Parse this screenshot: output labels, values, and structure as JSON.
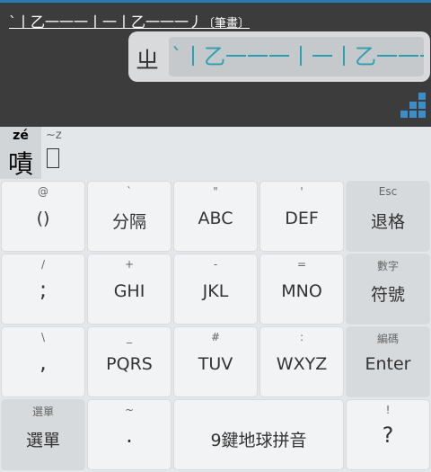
{
  "composing": {
    "strokes_text": "`丨乙一一一丨一丨乙一一一丿",
    "hint_text": "〔筆畫〕"
  },
  "bubble": {
    "key_char": "ㄓ",
    "strokes_text": "`丨乙一一一丨一丨乙一一一"
  },
  "candidates": {
    "main_pinyin": "zé",
    "main_char": "嘖",
    "alt_hint": "~z",
    "alt_char": ""
  },
  "keyboard": {
    "row1": [
      {
        "hint": "@",
        "label": "()"
      },
      {
        "hint": "`",
        "label": "分隔"
      },
      {
        "hint": "\"",
        "label": "ABC"
      },
      {
        "hint": "'",
        "label": "DEF"
      },
      {
        "hint": "Esc",
        "label": "退格"
      }
    ],
    "row2": [
      {
        "hint": "/",
        "label": ";"
      },
      {
        "hint": "+",
        "label": "GHI"
      },
      {
        "hint": "-",
        "label": "JKL"
      },
      {
        "hint": "=",
        "label": "MNO"
      },
      {
        "hint": "數字",
        "label": "符號"
      }
    ],
    "row3": [
      {
        "hint": "\\",
        "label": ","
      },
      {
        "hint": "_",
        "label": "PQRS"
      },
      {
        "hint": "#",
        "label": "TUV"
      },
      {
        "hint": ":",
        "label": "WXYZ"
      },
      {
        "hint": "編碼",
        "label": "Enter"
      }
    ],
    "row4": [
      {
        "hint": "選單",
        "label": "選單"
      },
      {
        "hint": "~",
        "label": "."
      },
      {
        "hint": "",
        "label": "9鍵地球拼音"
      },
      {
        "hint": "!",
        "label": "?"
      }
    ]
  },
  "colors": {
    "accent": "#2a7ab5",
    "stroke_text": "#2b9fb0",
    "stair_blocks": "#3c8ec8"
  }
}
